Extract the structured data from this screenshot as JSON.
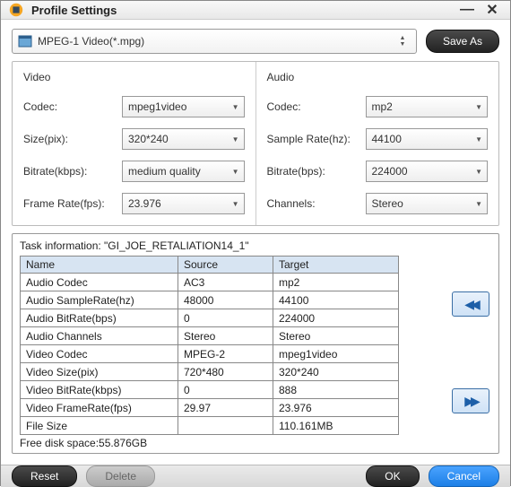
{
  "window": {
    "title": "Profile Settings"
  },
  "profile": {
    "selected": "MPEG-1 Video(*.mpg)",
    "save_as": "Save As"
  },
  "video": {
    "heading": "Video",
    "codec_label": "Codec:",
    "codec_value": "mpeg1video",
    "size_label": "Size(pix):",
    "size_value": "320*240",
    "bitrate_label": "Bitrate(kbps):",
    "bitrate_value": "medium quality",
    "fps_label": "Frame Rate(fps):",
    "fps_value": "23.976"
  },
  "audio": {
    "heading": "Audio",
    "codec_label": "Codec:",
    "codec_value": "mp2",
    "sr_label": "Sample Rate(hz):",
    "sr_value": "44100",
    "bitrate_label": "Bitrate(bps):",
    "bitrate_value": "224000",
    "channels_label": "Channels:",
    "channels_value": "Stereo"
  },
  "task": {
    "title_prefix": "Task information: ",
    "file": "\"GI_JOE_RETALIATION14_1\"",
    "cols": {
      "name": "Name",
      "source": "Source",
      "target": "Target"
    },
    "rows": [
      {
        "name": "Audio Codec",
        "source": "AC3",
        "target": "mp2"
      },
      {
        "name": "Audio SampleRate(hz)",
        "source": "48000",
        "target": "44100"
      },
      {
        "name": "Audio BitRate(bps)",
        "source": "0",
        "target": "224000"
      },
      {
        "name": "Audio Channels",
        "source": "Stereo",
        "target": "Stereo"
      },
      {
        "name": "Video Codec",
        "source": "MPEG-2",
        "target": "mpeg1video"
      },
      {
        "name": "Video Size(pix)",
        "source": "720*480",
        "target": "320*240"
      },
      {
        "name": "Video BitRate(kbps)",
        "source": "0",
        "target": "888"
      },
      {
        "name": "Video FrameRate(fps)",
        "source": "29.97",
        "target": "23.976"
      },
      {
        "name": "File Size",
        "source": "",
        "target": "110.161MB"
      }
    ],
    "free_space": "Free disk space:55.876GB"
  },
  "buttons": {
    "reset": "Reset",
    "delete": "Delete",
    "ok": "OK",
    "cancel": "Cancel"
  }
}
